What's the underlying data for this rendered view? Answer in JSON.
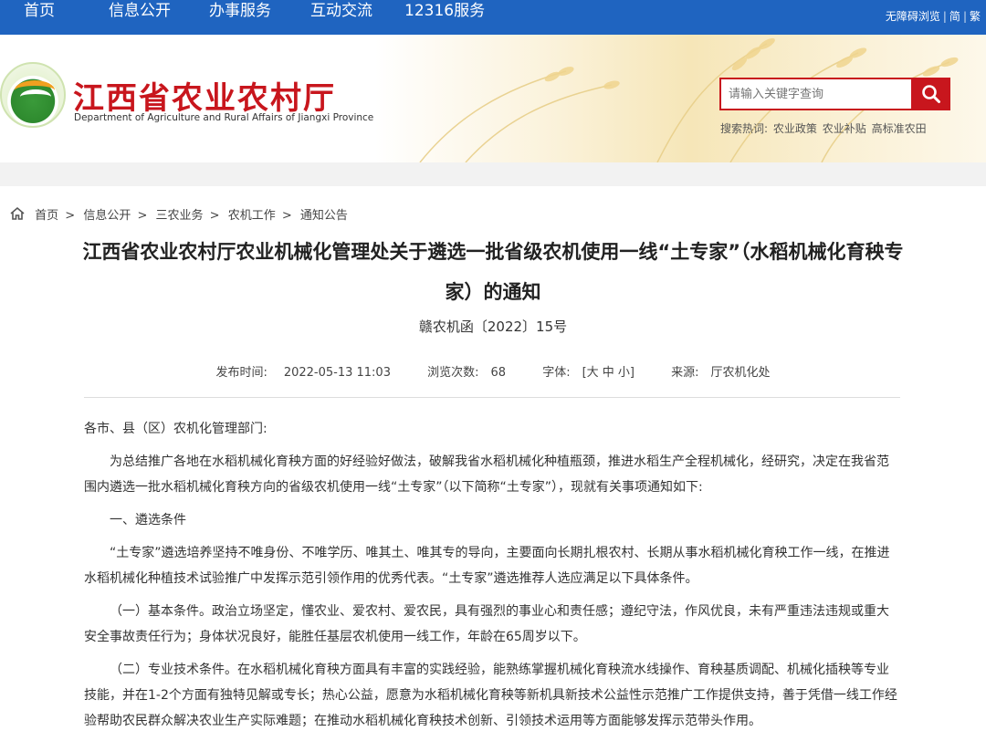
{
  "topnav": {
    "items": [
      "首页",
      "信息公开",
      "办事服务",
      "互动交流",
      "12316服务"
    ],
    "accessibility": "无障碍浏览",
    "simplified": "简",
    "traditional": "繁"
  },
  "header": {
    "title": "江西省农业农村厅",
    "subtitle": "Department of Agriculture and Rural Affairs of Jiangxi Province",
    "search_placeholder": "请输入关键字查询",
    "hot_label": "搜索热词:",
    "hot_words": [
      "农业政策",
      "农业补贴",
      "高标准农田"
    ]
  },
  "breadcrumb": [
    "首页",
    "信息公开",
    "三农业务",
    "农机工作",
    "通知公告"
  ],
  "article": {
    "title": "江西省农业农村厅农业机械化管理处关于遴选一批省级农机使用一线“土专家”（水稻机械化育秧专家）的通知",
    "doc_number": "赣农机函〔2022〕15号",
    "publish_label": "发布时间:",
    "publish_time": "2022-05-13 11:03",
    "views_label": "浏览次数:",
    "views": "68",
    "font_label": "字体:",
    "font_options": "[大 中 小]",
    "source_label": "来源:",
    "source": "厅农机化处",
    "paragraphs": [
      "各市、县（区）农机化管理部门:",
      "为总结推广各地在水稻机械化育秧方面的好经验好做法，破解我省水稻机械化种植瓶颈，推进水稻生产全程机械化，经研究，决定在我省范围内遴选一批水稻机械化育秧方向的省级农机使用一线“土专家”（以下简称“土专家”），现就有关事项通知如下:",
      "一、遴选条件",
      "“土专家”遴选培养坚持不唯身份、不唯学历、唯其土、唯其专的导向，主要面向长期扎根农村、长期从事水稻机械化育秧工作一线，在推进水稻机械化种植技术试验推广中发挥示范引领作用的优秀代表。“土专家”遴选推荐人选应满足以下具体条件。",
      "（一）基本条件。政治立场坚定，懂农业、爱农村、爱农民，具有强烈的事业心和责任感；遵纪守法，作风优良，未有严重违法违规或重大安全事故责任行为；身体状况良好，能胜任基层农机使用一线工作，年龄在65周岁以下。",
      "（二）专业技术条件。在水稻机械化育秧方面具有丰富的实践经验，能熟练掌握机械化育秧流水线操作、育秧基质调配、机械化插秧等专业技能，并在1-2个方面有独特见解或专长；热心公益，愿意为水稻机械化育秧等新机具新技术公益性示范推广工作提供支持，善于凭借一线工作经验帮助农民群众解决农业生产实际难题；在推动水稻机械化育秧技术创新、引领技术运用等方面能够发挥示范带头作用。"
    ]
  }
}
